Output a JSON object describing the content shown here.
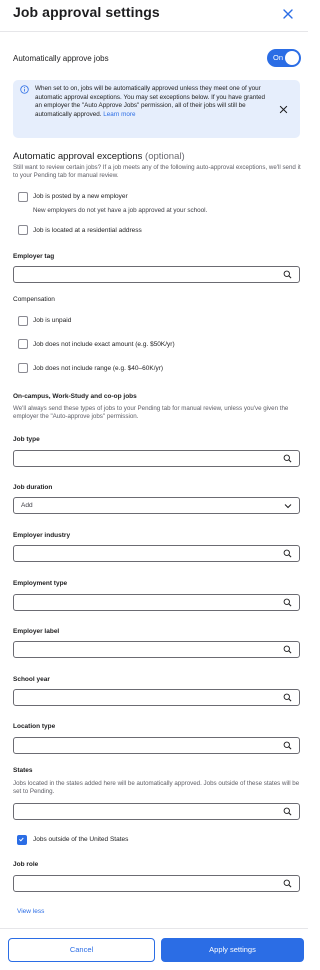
{
  "header": {
    "title": "Job approval settings"
  },
  "auto_approve": {
    "label": "Automatically approve jobs",
    "toggle_label": "On"
  },
  "info": {
    "text": "When set to on, jobs will be automatically approved unless they meet one of your automatic approval exceptions. You may set exceptions below. If you have granted an employer the \"Auto Approve Jobs\" permission, all of their jobs will still be automatically approved.",
    "link": "Learn more"
  },
  "exceptions": {
    "title": "Automatic approval exceptions",
    "optional": "(optional)",
    "subtitle": "Still want to review certain jobs? If a job meets any of the following auto-approval exceptions, we'll send it to your Pending tab for manual review.",
    "new_employer": "Job is posted by a new employer",
    "new_employer_sub": "New employers do not yet have a job approved at your school.",
    "residential": "Job is located at a residential address"
  },
  "employer_tag": {
    "label": "Employer tag"
  },
  "compensation": {
    "label": "Compensation",
    "unpaid": "Job is unpaid",
    "no_exact": "Job does not include exact amount (e.g. $50K/yr)",
    "no_range": "Job does not include range (e.g. $40–60K/yr)"
  },
  "oncampus": {
    "title": "On-campus, Work-Study and co-op jobs",
    "subtitle": "We'll always send these types of jobs to your Pending tab for manual review, unless you've given the employer the \"Auto-approve jobs\" permission."
  },
  "fields": {
    "job_type": "Job type",
    "job_duration": "Job duration",
    "job_duration_value": "Add",
    "employer_industry": "Employer industry",
    "employment_type": "Employment type",
    "employer_label": "Employer label",
    "school_year": "School year",
    "location_type": "Location type",
    "states": "States",
    "states_sub": "Jobs located in the states added here will be automatically approved. Jobs outside of these states will be set to Pending.",
    "outside_us": "Jobs outside of the United States",
    "job_role": "Job role"
  },
  "view_less": "View less",
  "footer": {
    "cancel": "Cancel",
    "apply": "Apply settings"
  },
  "colors": {
    "accent": "#2b6de5",
    "info_bg": "#e6eefc"
  }
}
